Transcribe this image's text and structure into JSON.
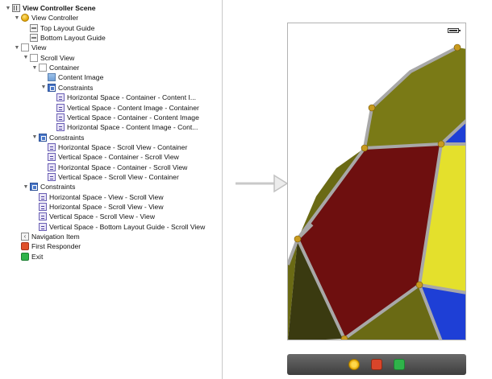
{
  "outline": {
    "items": [
      {
        "label": "View Controller Scene",
        "icon": "scene-icon",
        "disclosure": "open",
        "bold": true
      },
      {
        "label": "View Controller",
        "icon": "view-controller-icon",
        "disclosure": "open"
      },
      {
        "label": "Top Layout Guide",
        "icon": "layout-guide-icon",
        "disclosure": ""
      },
      {
        "label": "Bottom Layout Guide",
        "icon": "layout-guide-icon",
        "disclosure": ""
      },
      {
        "label": "View",
        "icon": "view-icon",
        "disclosure": "open"
      },
      {
        "label": "Scroll View",
        "icon": "view-icon",
        "disclosure": "open"
      },
      {
        "label": "Container",
        "icon": "view-icon",
        "disclosure": "open"
      },
      {
        "label": "Content Image",
        "icon": "image-view-icon",
        "disclosure": ""
      },
      {
        "label": "Constraints",
        "icon": "constraints-icon",
        "disclosure": "open"
      },
      {
        "label": "Horizontal Space - Container - Content I...",
        "icon": "constraint-icon",
        "disclosure": ""
      },
      {
        "label": "Vertical Space - Content Image - Container",
        "icon": "constraint-icon",
        "disclosure": ""
      },
      {
        "label": "Vertical Space - Container - Content Image",
        "icon": "constraint-icon",
        "disclosure": ""
      },
      {
        "label": "Horizontal Space - Content Image - Cont...",
        "icon": "constraint-icon",
        "disclosure": ""
      },
      {
        "label": "Constraints",
        "icon": "constraints-icon",
        "disclosure": "open"
      },
      {
        "label": "Horizontal Space - Scroll View - Container",
        "icon": "constraint-icon",
        "disclosure": ""
      },
      {
        "label": "Vertical Space - Container - Scroll View",
        "icon": "constraint-icon",
        "disclosure": ""
      },
      {
        "label": "Horizontal Space - Container - Scroll View",
        "icon": "constraint-icon",
        "disclosure": ""
      },
      {
        "label": "Vertical Space - Scroll View - Container",
        "icon": "constraint-icon",
        "disclosure": ""
      },
      {
        "label": "Constraints",
        "icon": "constraints-icon",
        "disclosure": "open"
      },
      {
        "label": "Horizontal Space - View - Scroll View",
        "icon": "constraint-icon",
        "disclosure": ""
      },
      {
        "label": "Horizontal Space - Scroll View - View",
        "icon": "constraint-icon",
        "disclosure": ""
      },
      {
        "label": "Vertical Space - Scroll View - View",
        "icon": "constraint-icon",
        "disclosure": ""
      },
      {
        "label": "Vertical Space - Bottom Layout Guide - Scroll View",
        "icon": "constraint-icon",
        "disclosure": ""
      },
      {
        "label": "Navigation Item",
        "icon": "navigation-item-icon",
        "disclosure": ""
      },
      {
        "label": "First Responder",
        "icon": "first-responder-icon",
        "disclosure": ""
      },
      {
        "label": "Exit",
        "icon": "exit-icon",
        "disclosure": ""
      }
    ]
  },
  "canvas": {
    "entry_arrow_icon": "storyboard-entry-arrow-icon",
    "content_image": {
      "description_icon": "polyhedron-icon",
      "colors": {
        "dark_red": "#6e0f0f",
        "olive": "#7a7a16",
        "yellow": "#e4e02c",
        "blue": "#1e3fd6",
        "navy": "#0c1660",
        "edge": "#9a9a9a",
        "vertex": "#c89a1e"
      }
    },
    "dock": {
      "icons": [
        "view-controller-icon",
        "first-responder-icon",
        "exit-icon"
      ]
    }
  }
}
